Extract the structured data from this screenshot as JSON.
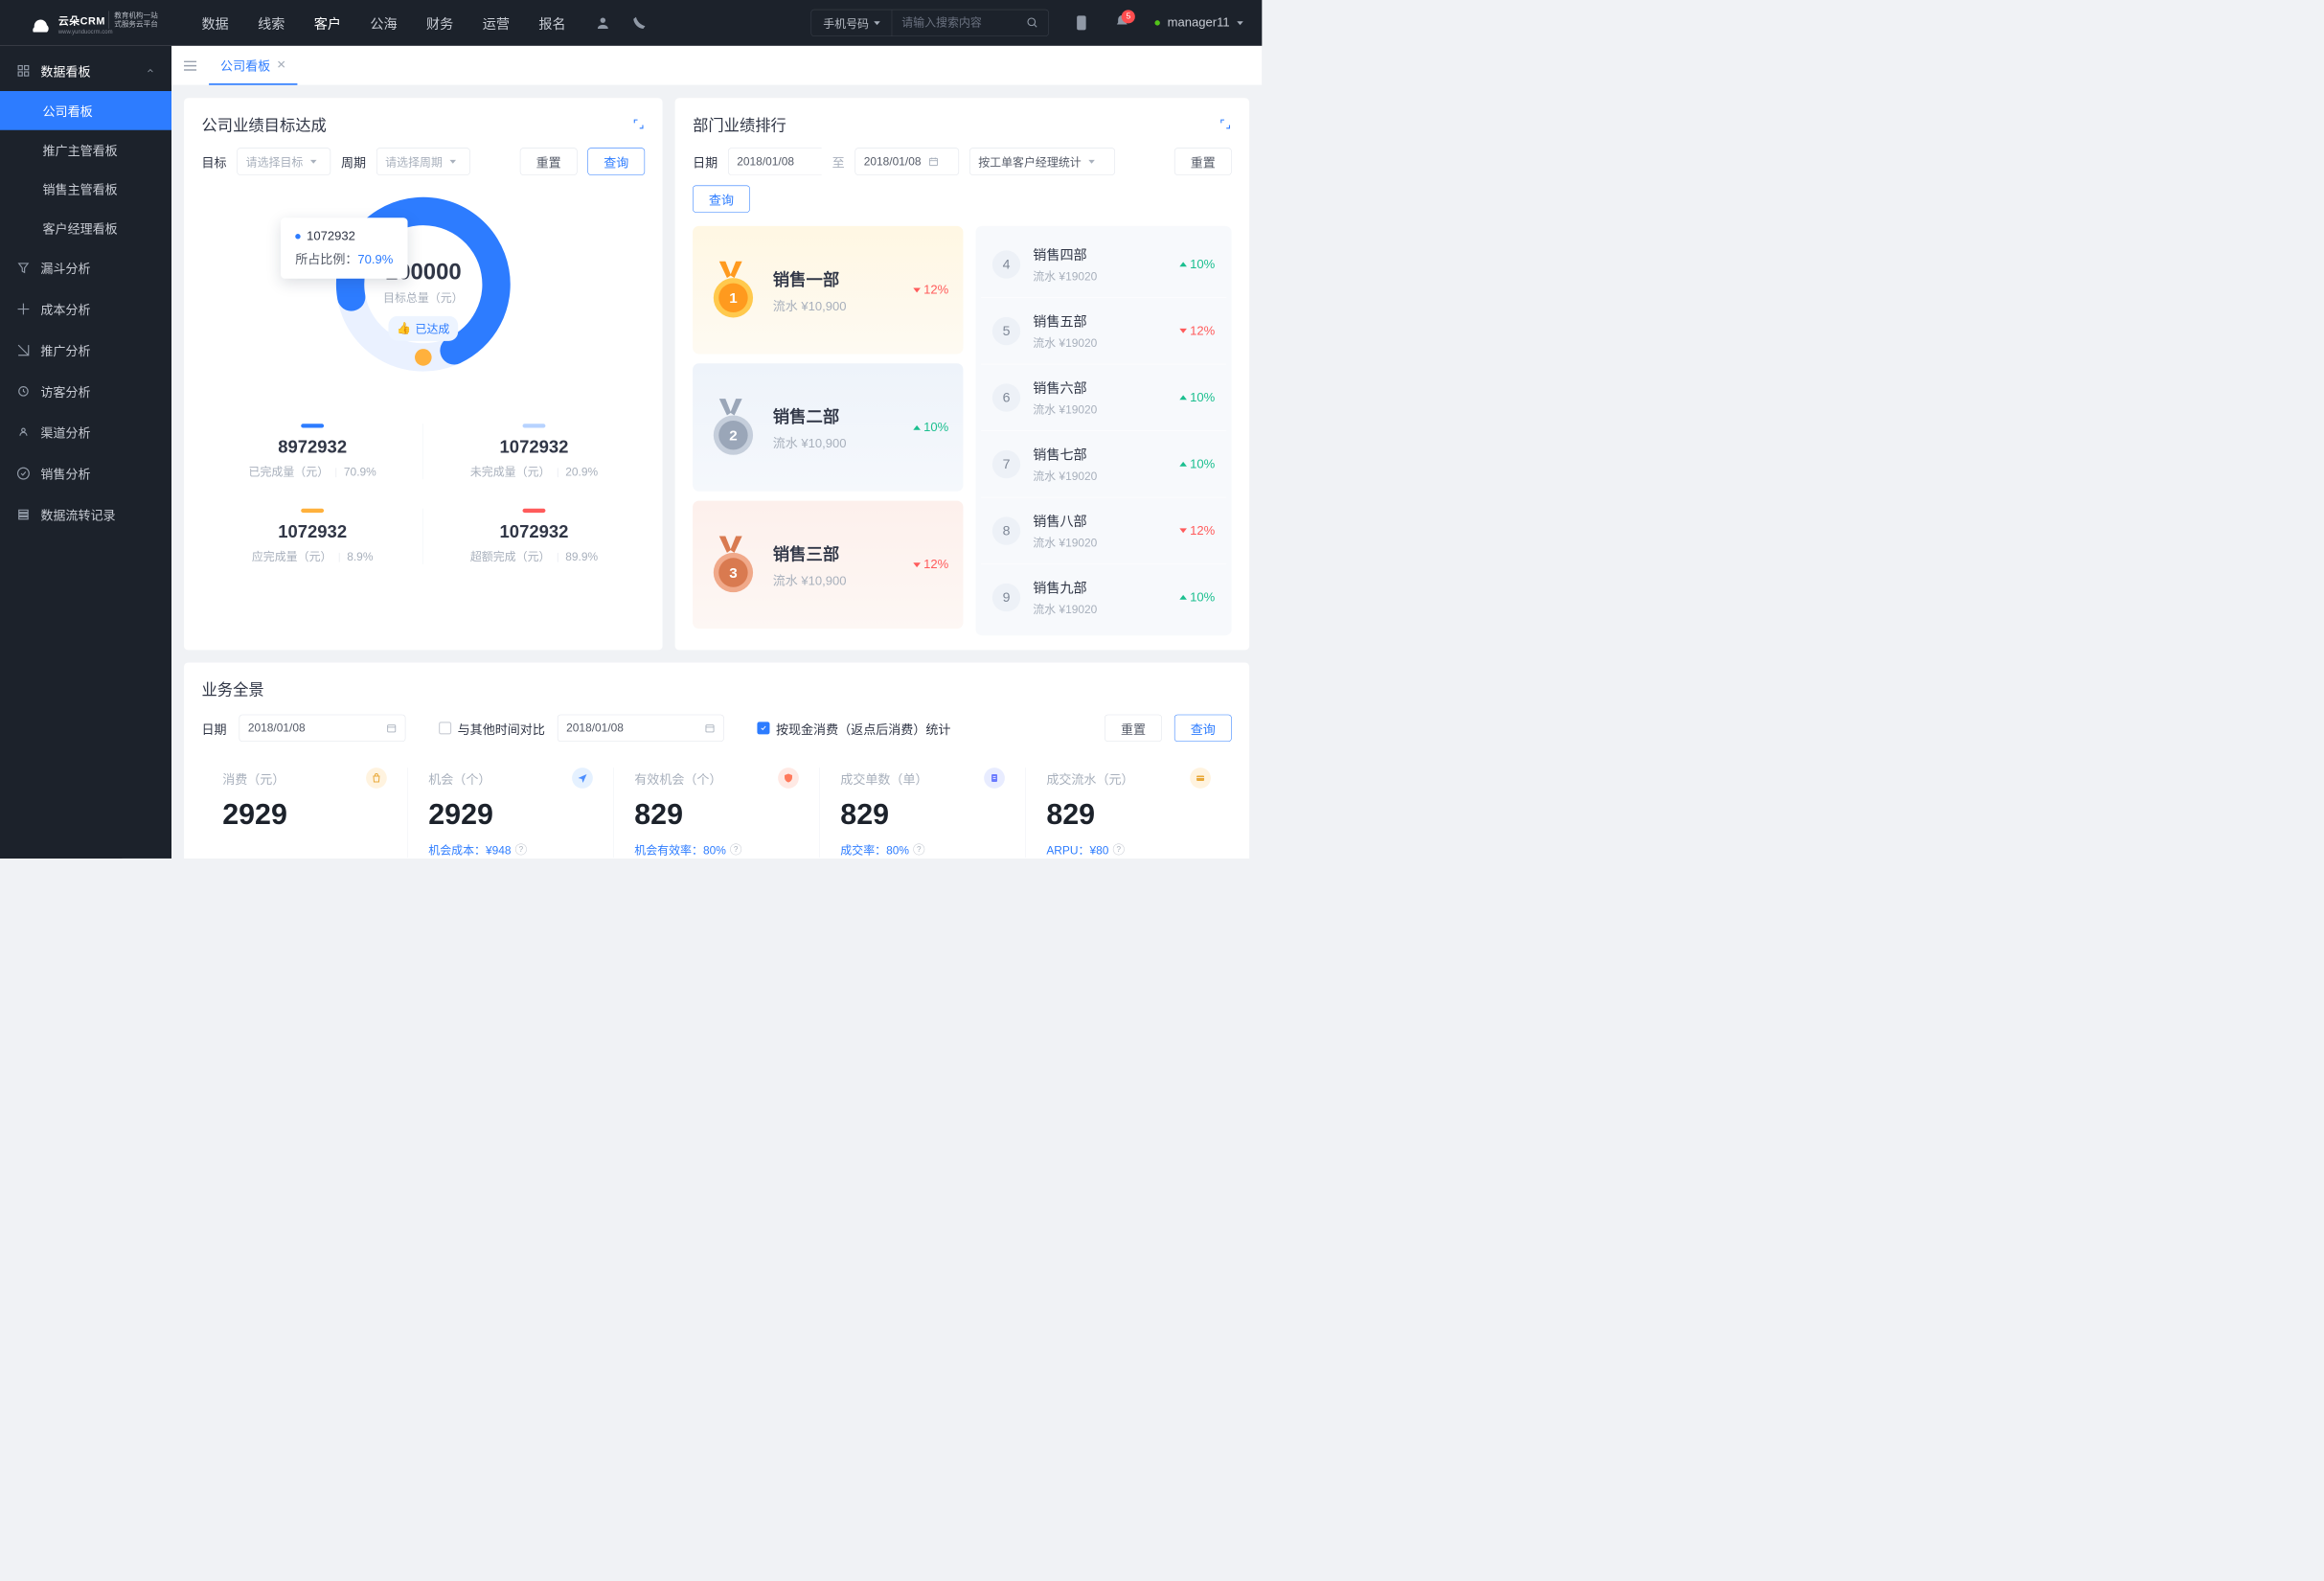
{
  "brand": {
    "name": "云朵CRM",
    "tagline1": "教育机构一站",
    "tagline2": "式服务云平台",
    "url": "www.yunduocrm.com"
  },
  "nav": [
    "数据",
    "线索",
    "客户",
    "公海",
    "财务",
    "运营",
    "报名"
  ],
  "nav_active_index": 2,
  "search": {
    "type": "手机号码",
    "placeholder": "请输入搜索内容"
  },
  "notifications": "5",
  "user": "manager11",
  "sidebar": {
    "group_title": "数据看板",
    "items": [
      "公司看板",
      "推广主管看板",
      "销售主管看板",
      "客户经理看板"
    ],
    "active_index": 0,
    "rows": [
      "漏斗分析",
      "成本分析",
      "推广分析",
      "访客分析",
      "渠道分析",
      "销售分析",
      "数据流转记录"
    ]
  },
  "tab": {
    "label": "公司看板"
  },
  "goal": {
    "title": "公司业绩目标达成",
    "filters": {
      "target_label": "目标",
      "target_ph": "请选择目标",
      "period_label": "周期",
      "period_ph": "请选择周期",
      "reset": "重置",
      "query": "查询"
    },
    "donut": {
      "total": "100000",
      "total_label": "目标总量（元）",
      "badge": "已达成",
      "tooltip_val": "1072932",
      "tooltip_label": "所占比例：",
      "tooltip_pct": "70.9%"
    },
    "stats": [
      {
        "color": "#2d7cff",
        "val": "8972932",
        "label": "已完成量（元）",
        "pct": "70.9%"
      },
      {
        "color": "#b7d3ff",
        "val": "1072932",
        "label": "未完成量（元）",
        "pct": "20.9%"
      },
      {
        "color": "#ffb13d",
        "val": "1072932",
        "label": "应完成量（元）",
        "pct": "8.9%"
      },
      {
        "color": "#ff5b5b",
        "val": "1072932",
        "label": "超额完成（元）",
        "pct": "89.9%"
      }
    ]
  },
  "rank": {
    "title": "部门业绩排行",
    "filters": {
      "date_label": "日期",
      "from": "2018/01/08",
      "to_label": "至",
      "to": "2018/01/08",
      "stat": "按工单客户经理统计",
      "reset": "重置",
      "query": "查询"
    },
    "top3": [
      {
        "name": "销售一部",
        "sub": "流水 ¥10,900",
        "delta": "12%",
        "dir": "down"
      },
      {
        "name": "销售二部",
        "sub": "流水 ¥10,900",
        "delta": "10%",
        "dir": "up"
      },
      {
        "name": "销售三部",
        "sub": "流水 ¥10,900",
        "delta": "12%",
        "dir": "down"
      }
    ],
    "list": [
      {
        "n": "4",
        "name": "销售四部",
        "sub": "流水 ¥19020",
        "delta": "10%",
        "dir": "up"
      },
      {
        "n": "5",
        "name": "销售五部",
        "sub": "流水 ¥19020",
        "delta": "12%",
        "dir": "down"
      },
      {
        "n": "6",
        "name": "销售六部",
        "sub": "流水 ¥19020",
        "delta": "10%",
        "dir": "up"
      },
      {
        "n": "7",
        "name": "销售七部",
        "sub": "流水 ¥19020",
        "delta": "10%",
        "dir": "up"
      },
      {
        "n": "8",
        "name": "销售八部",
        "sub": "流水 ¥19020",
        "delta": "12%",
        "dir": "down"
      },
      {
        "n": "9",
        "name": "销售九部",
        "sub": "流水 ¥19020",
        "delta": "10%",
        "dir": "up"
      }
    ]
  },
  "panorama": {
    "title": "业务全景",
    "date_label": "日期",
    "date1": "2018/01/08",
    "compare_label": "与其他时间对比",
    "date2": "2018/01/08",
    "checkbox_label": "按现金消费（返点后消费）统计",
    "reset": "重置",
    "query": "查询",
    "metrics": [
      {
        "label": "消费（元）",
        "val": "2929",
        "foot": "",
        "icon_bg": "#fff3df",
        "icon": "bag"
      },
      {
        "label": "机会（个）",
        "val": "2929",
        "foot": "机会成本：¥948",
        "icon_bg": "#e5f1ff",
        "icon": "send"
      },
      {
        "label": "有效机会（个）",
        "val": "829",
        "foot": "机会有效率：80%",
        "icon_bg": "#ffe9e4",
        "icon": "shield"
      },
      {
        "label": "成交单数（单）",
        "val": "829",
        "foot": "成交率：80%",
        "icon_bg": "#e8ecff",
        "icon": "doc"
      },
      {
        "label": "成交流水（元）",
        "val": "829",
        "foot": "ARPU：¥80",
        "icon_bg": "#fff3df",
        "icon": "card"
      }
    ]
  },
  "chart_data": {
    "type": "pie",
    "title": "公司业绩目标达成",
    "total": 100000,
    "unit": "元",
    "series": [
      {
        "name": "已完成量",
        "value": 8972932,
        "pct": 70.9,
        "color": "#2d7cff"
      },
      {
        "name": "未完成量",
        "value": 1072932,
        "pct": 20.9,
        "color": "#b7d3ff"
      },
      {
        "name": "应完成量",
        "value": 1072932,
        "pct": 8.9,
        "color": "#ffb13d"
      },
      {
        "name": "超额完成",
        "value": 1072932,
        "pct": 89.9,
        "color": "#ff5b5b"
      }
    ],
    "highlighted": {
      "name": "1072932",
      "pct": 70.9
    }
  }
}
